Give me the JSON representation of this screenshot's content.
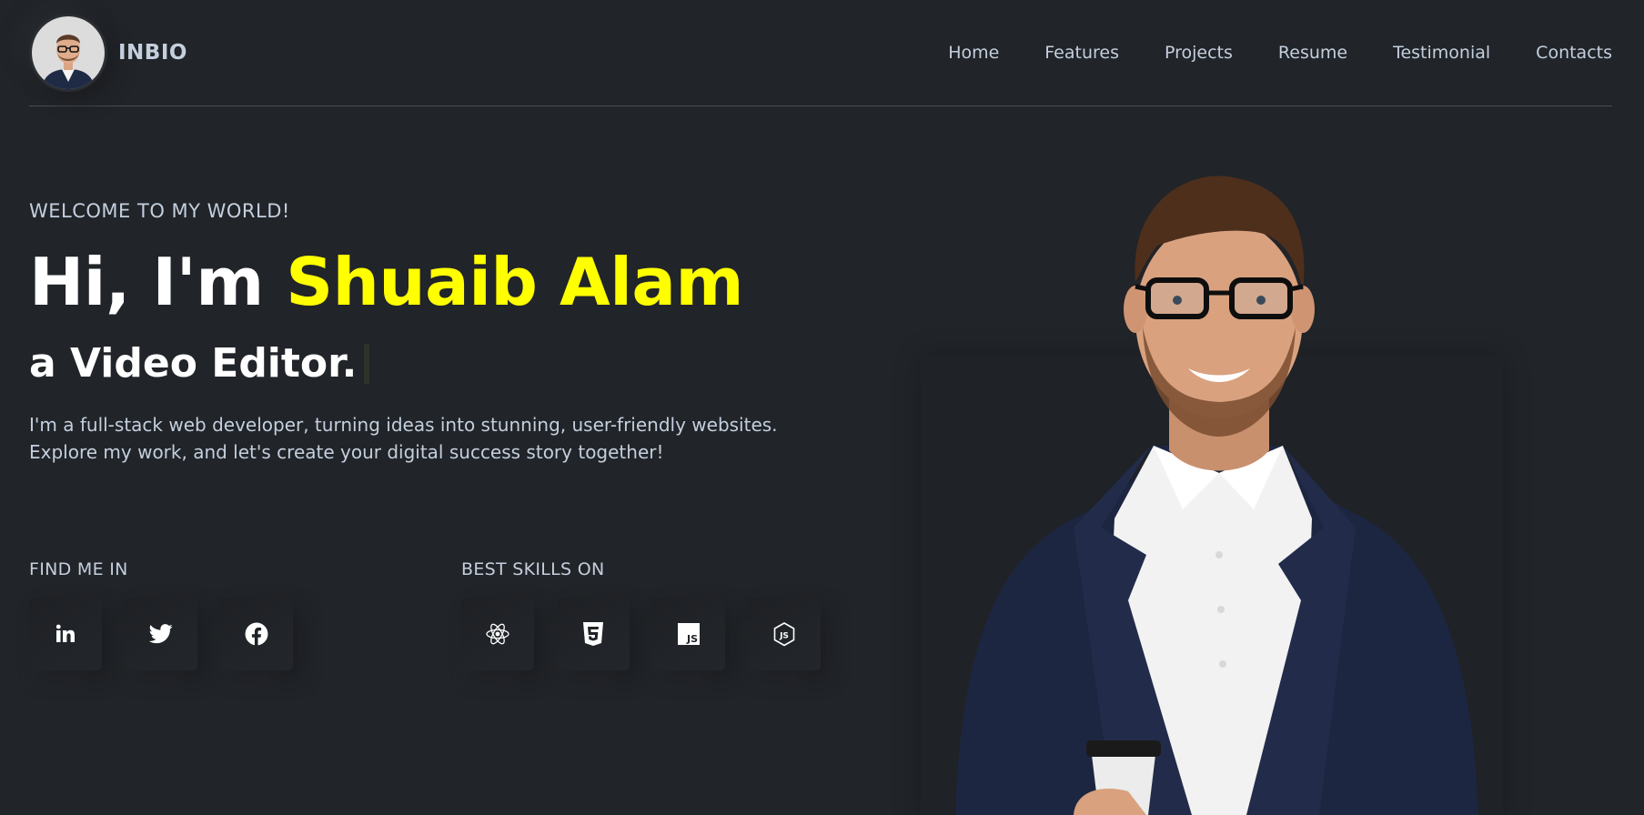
{
  "header": {
    "brand_name": "INBIO",
    "avatar": "profile-photo",
    "nav": [
      "Home",
      "Features",
      "Projects",
      "Resume",
      "Testimonial",
      "Contacts"
    ]
  },
  "hero": {
    "welcome": "WELCOME TO MY WORLD!",
    "greeting": "Hi, I'm ",
    "name": "Shuaib Alam",
    "role": "a Video Editor.",
    "intro_line1": "I'm a full-stack web developer, turning ideas into stunning, user-friendly websites.",
    "intro_line2": "Explore my work, and let's create your digital success story together!"
  },
  "social": {
    "title": "FIND ME IN",
    "icons": [
      "linkedin-icon",
      "twitter-icon",
      "facebook-icon"
    ]
  },
  "skills": {
    "title": "BEST SKILLS ON",
    "icons": [
      "react-icon",
      "html5-icon",
      "javascript-icon",
      "nodejs-icon"
    ]
  },
  "colors": {
    "background": "#212428",
    "accent": "#ffff00",
    "text": "#c4cfde",
    "heading": "#ffffff"
  }
}
